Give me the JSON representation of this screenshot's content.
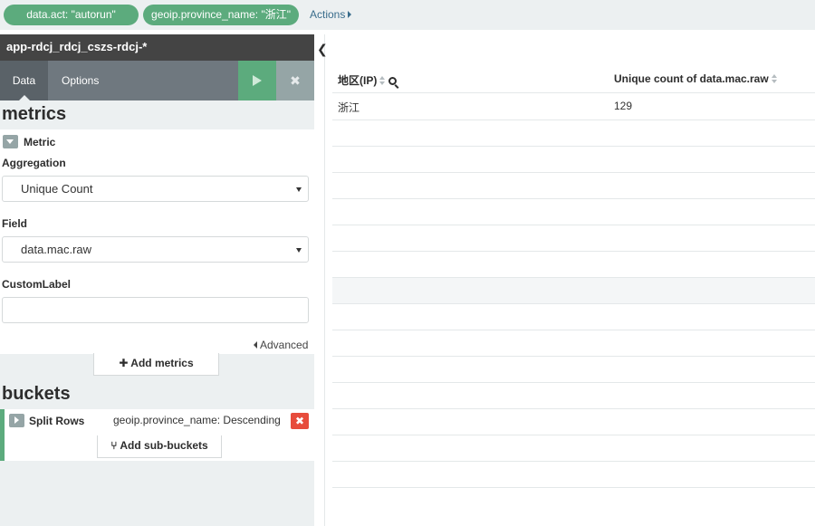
{
  "filters": [
    {
      "label": "data.act: \"autorun\""
    },
    {
      "label": "geoip.province_name: \"浙江\""
    }
  ],
  "actions_label": "Actions",
  "sidebar": {
    "index_pattern": "app-rdcj_rdcj_cszs-rdcj-*",
    "tabs": [
      {
        "label": "Data"
      },
      {
        "label": "Options"
      }
    ],
    "apply_icon": "play-icon",
    "discard_icon": "close-icon",
    "metrics": {
      "title": "metrics",
      "metric_label": "Metric",
      "aggregation_label": "Aggregation",
      "aggregation_value": "Unique Count",
      "field_label": "Field",
      "field_value": "data.mac.raw",
      "custom_label_label": "CustomLabel",
      "custom_label_value": "",
      "advanced_label": "Advanced",
      "add_label": "Add metrics"
    },
    "buckets": {
      "title": "buckets",
      "split_label": "Split Rows",
      "split_desc": "geoip.province_name: Descending",
      "remove_icon": "✖",
      "add_label": "Add sub-buckets"
    }
  },
  "table": {
    "headers": [
      "地区(IP)",
      "Unique count of data.mac.raw"
    ],
    "rows": [
      [
        "浙江",
        "129"
      ]
    ]
  },
  "colors": {
    "accent": "#5cab7d",
    "danger": "#e74c3c",
    "header": "#444444"
  }
}
